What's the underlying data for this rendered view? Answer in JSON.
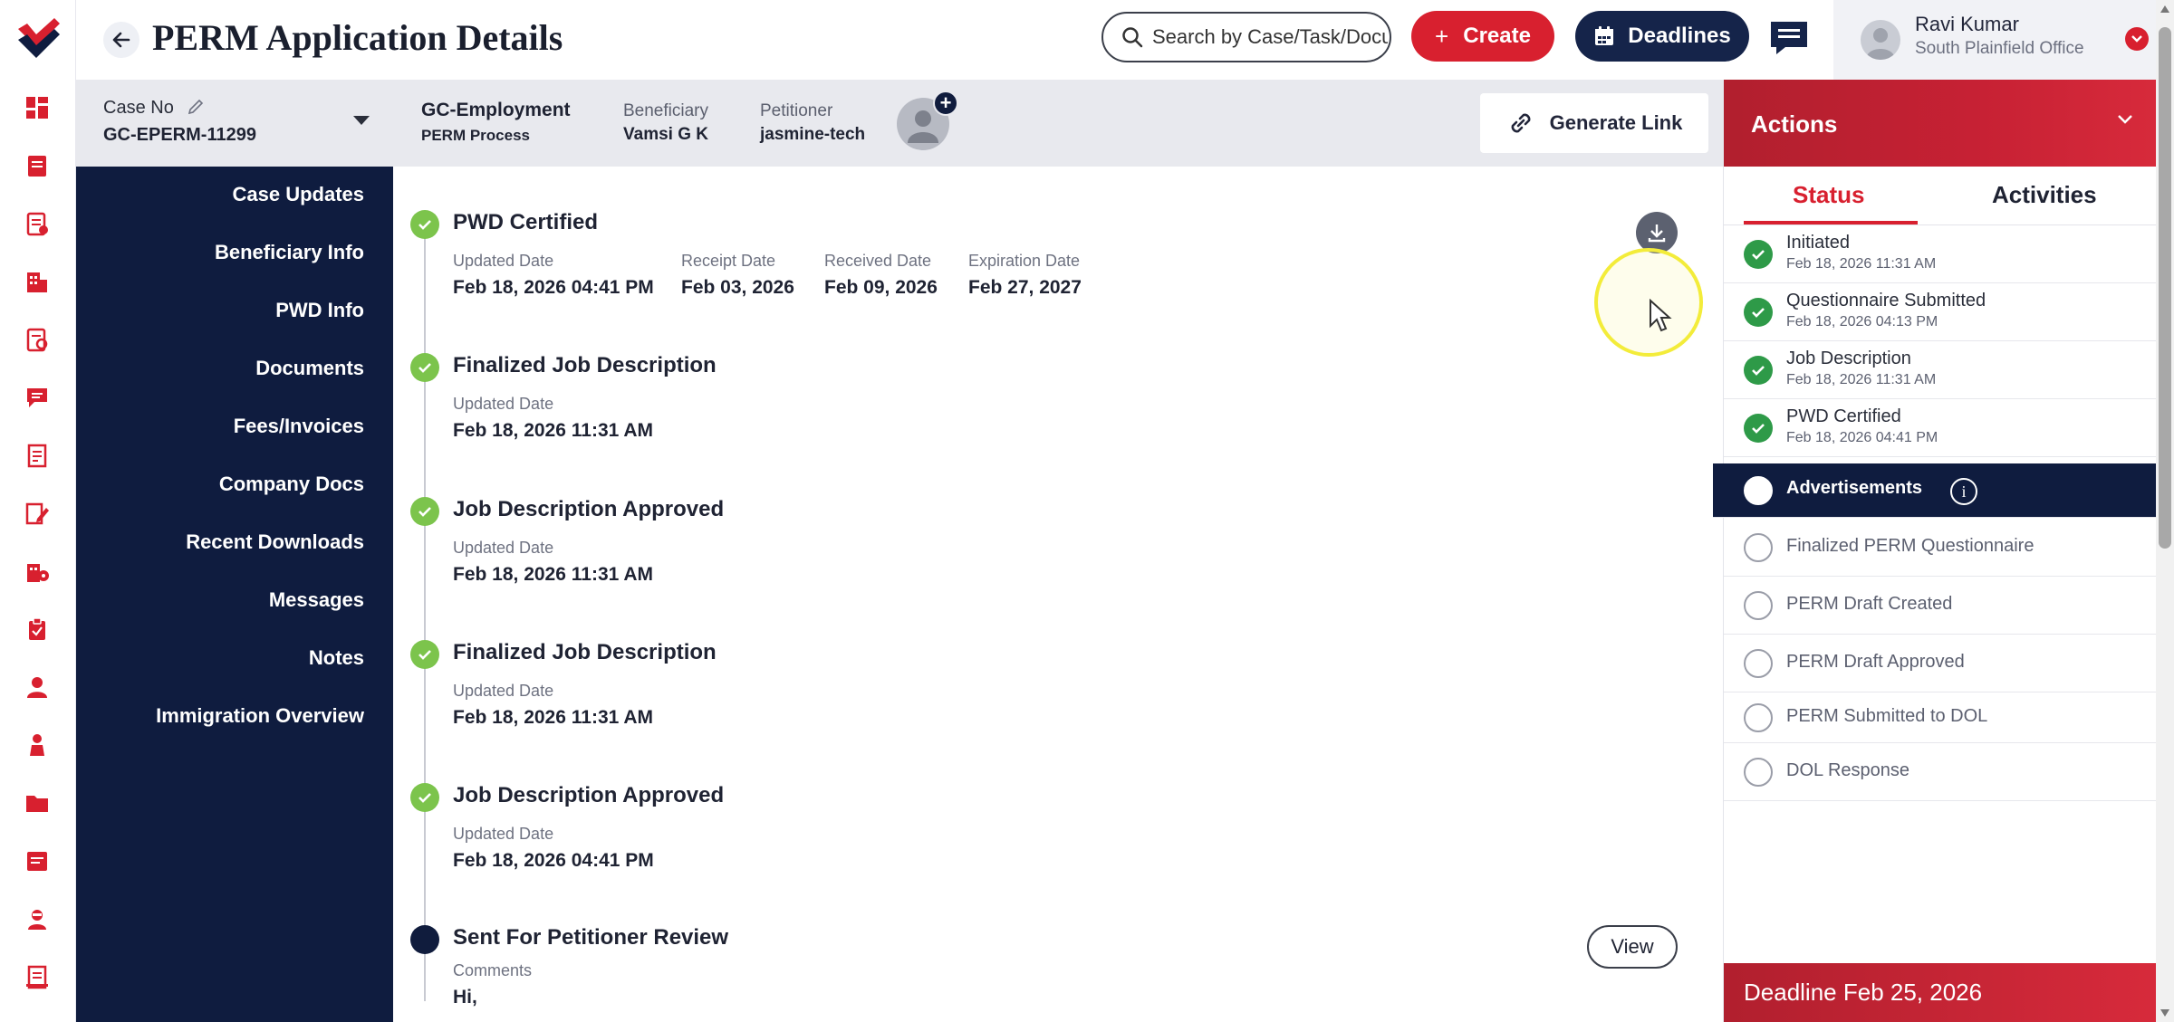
{
  "header": {
    "title": "PERM Application Details",
    "search_placeholder": "Search by Case/Task/Docu",
    "create_label": "Create",
    "deadlines_label": "Deadlines",
    "user_name": "Ravi Kumar",
    "user_office": "South Plainfield Office"
  },
  "case": {
    "case_no_label": "Case No",
    "case_no": "GC-EPERM-11299",
    "case_type": "GC-Employment",
    "process": "PERM Process",
    "beneficiary_label": "Beneficiary",
    "beneficiary": "Vamsi G K",
    "petitioner_label": "Petitioner",
    "petitioner": "jasmine-tech",
    "generate_link_label": "Generate Link"
  },
  "nav": {
    "items": [
      "Case Updates",
      "Beneficiary Info",
      "PWD Info",
      "Documents",
      "Fees/Invoices",
      "Company Docs",
      "Recent Downloads",
      "Messages",
      "Notes",
      "Immigration Overview"
    ]
  },
  "timeline": [
    {
      "title": "PWD Certified",
      "fields": [
        {
          "label": "Updated Date",
          "value": "Feb 18, 2026 04:41 PM"
        },
        {
          "label": "Receipt Date",
          "value": "Feb 03, 2026"
        },
        {
          "label": "Received Date",
          "value": "Feb 09, 2026"
        },
        {
          "label": "Expiration Date",
          "value": "Feb 27, 2027"
        }
      ]
    },
    {
      "title": "Finalized Job Description",
      "fields": [
        {
          "label": "Updated Date",
          "value": "Feb 18, 2026 11:31 AM"
        }
      ]
    },
    {
      "title": "Job Description Approved",
      "fields": [
        {
          "label": "Updated Date",
          "value": "Feb 18, 2026 11:31 AM"
        }
      ]
    },
    {
      "title": "Finalized Job Description",
      "fields": [
        {
          "label": "Updated Date",
          "value": "Feb 18, 2026 11:31 AM"
        }
      ]
    },
    {
      "title": "Job Description Approved",
      "fields": [
        {
          "label": "Updated Date",
          "value": "Feb 18, 2026 04:41 PM"
        }
      ]
    },
    {
      "title": "Sent For Petitioner Review",
      "fields": [
        {
          "label": "Comments",
          "value": "Hi,"
        }
      ],
      "view_label": "View"
    }
  ],
  "actions": {
    "title": "Actions",
    "tab_status": "Status",
    "tab_activities": "Activities",
    "statuses": [
      {
        "name": "Initiated",
        "date": "Feb 18, 2026 11:31 AM",
        "state": "done"
      },
      {
        "name": "Questionnaire Submitted",
        "date": "Feb 18, 2026 04:13 PM",
        "state": "done"
      },
      {
        "name": "Job Description",
        "date": "Feb 18, 2026 11:31 AM",
        "state": "done"
      },
      {
        "name": "PWD Certified",
        "date": "Feb 18, 2026 04:41 PM",
        "state": "done"
      },
      {
        "name": "Advertisements",
        "date": "",
        "state": "active"
      },
      {
        "name": "Finalized PERM Questionnaire",
        "date": "",
        "state": "pending"
      },
      {
        "name": "PERM Draft Created",
        "date": "",
        "state": "pending"
      },
      {
        "name": "PERM Draft Approved",
        "date": "",
        "state": "pending"
      },
      {
        "name": "PERM Submitted to DOL",
        "date": "",
        "state": "pending"
      },
      {
        "name": "DOL Response",
        "date": "",
        "state": "pending"
      }
    ],
    "deadline_text": "Deadline Feb 25, 2026"
  },
  "colors": {
    "brand_red": "#d8202f",
    "navy": "#0f1c3f",
    "success_green": "#2e9a48",
    "timeline_green": "#7cc44c"
  }
}
